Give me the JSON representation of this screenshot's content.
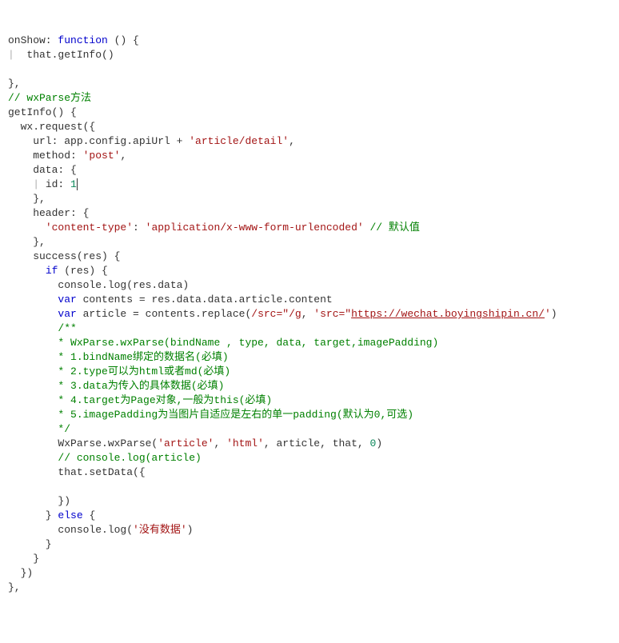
{
  "code": {
    "l01a": "onShow: ",
    "l01b": "function",
    "l01c": " () {",
    "l02a": "  that.getInfo()",
    "l04a": "},",
    "l05a": "// wxParse方法",
    "l06a": "getInfo() {",
    "l07a": "  wx.request({",
    "l08a": "    url: app.config.apiUrl + ",
    "l08b": "'article/detail'",
    "l08c": ",",
    "l09a": "    method: ",
    "l09b": "'post'",
    "l09c": ",",
    "l10a": "    data: {",
    "l11a": "      id: ",
    "l11b": "1",
    "l12a": "    },",
    "l13a": "    header: {",
    "l14a": "      ",
    "l14b": "'content-type'",
    "l14c": ": ",
    "l14d": "'application/x-www-form-urlencoded'",
    "l14e": " // 默认值",
    "l15a": "    },",
    "l16a": "    success(res) {",
    "l17a": "      ",
    "l17b": "if",
    "l17c": " (res) {",
    "l18a": "        console.log(res.data)",
    "l19a": "        ",
    "l19b": "var",
    "l19c": " contents = res.data.data.article.content",
    "l20a": "        ",
    "l20b": "var",
    "l20c": " article = contents.replace(",
    "l20d": "/src=\"/g",
    "l20e": ", ",
    "l20f": "'src=\"",
    "l20g": "https://wechat.boyingshipin.cn/",
    "l20h": "'",
    "l20i": ")",
    "l21a": "        /**",
    "l22a": "        * WxParse.wxParse(bindName , type, data, target,imagePadding)",
    "l23a": "        * 1.bindName绑定的数据名(必填)",
    "l24a": "        * 2.type可以为html或者md(必填)",
    "l25a": "        * 3.data为传入的具体数据(必填)",
    "l26a": "        * 4.target为Page对象,一般为this(必填)",
    "l27a": "        * 5.imagePadding为当图片自适应是左右的单一padding(默认为0,可选)",
    "l28a": "        */",
    "l29a": "        WxParse.wxParse(",
    "l29b": "'article'",
    "l29c": ", ",
    "l29d": "'html'",
    "l29e": ", article, that, ",
    "l29f": "0",
    "l29g": ")",
    "l30a": "        // console.log(article)",
    "l31a": "        that.setData({",
    "l33a": "        })",
    "l34a": "      } ",
    "l34b": "else",
    "l34c": " {",
    "l35a": "        console.log(",
    "l35b": "'没有数据'",
    "l35c": ")",
    "l36a": "      }",
    "l37a": "    }",
    "l38a": "  })",
    "l39a": "},"
  }
}
